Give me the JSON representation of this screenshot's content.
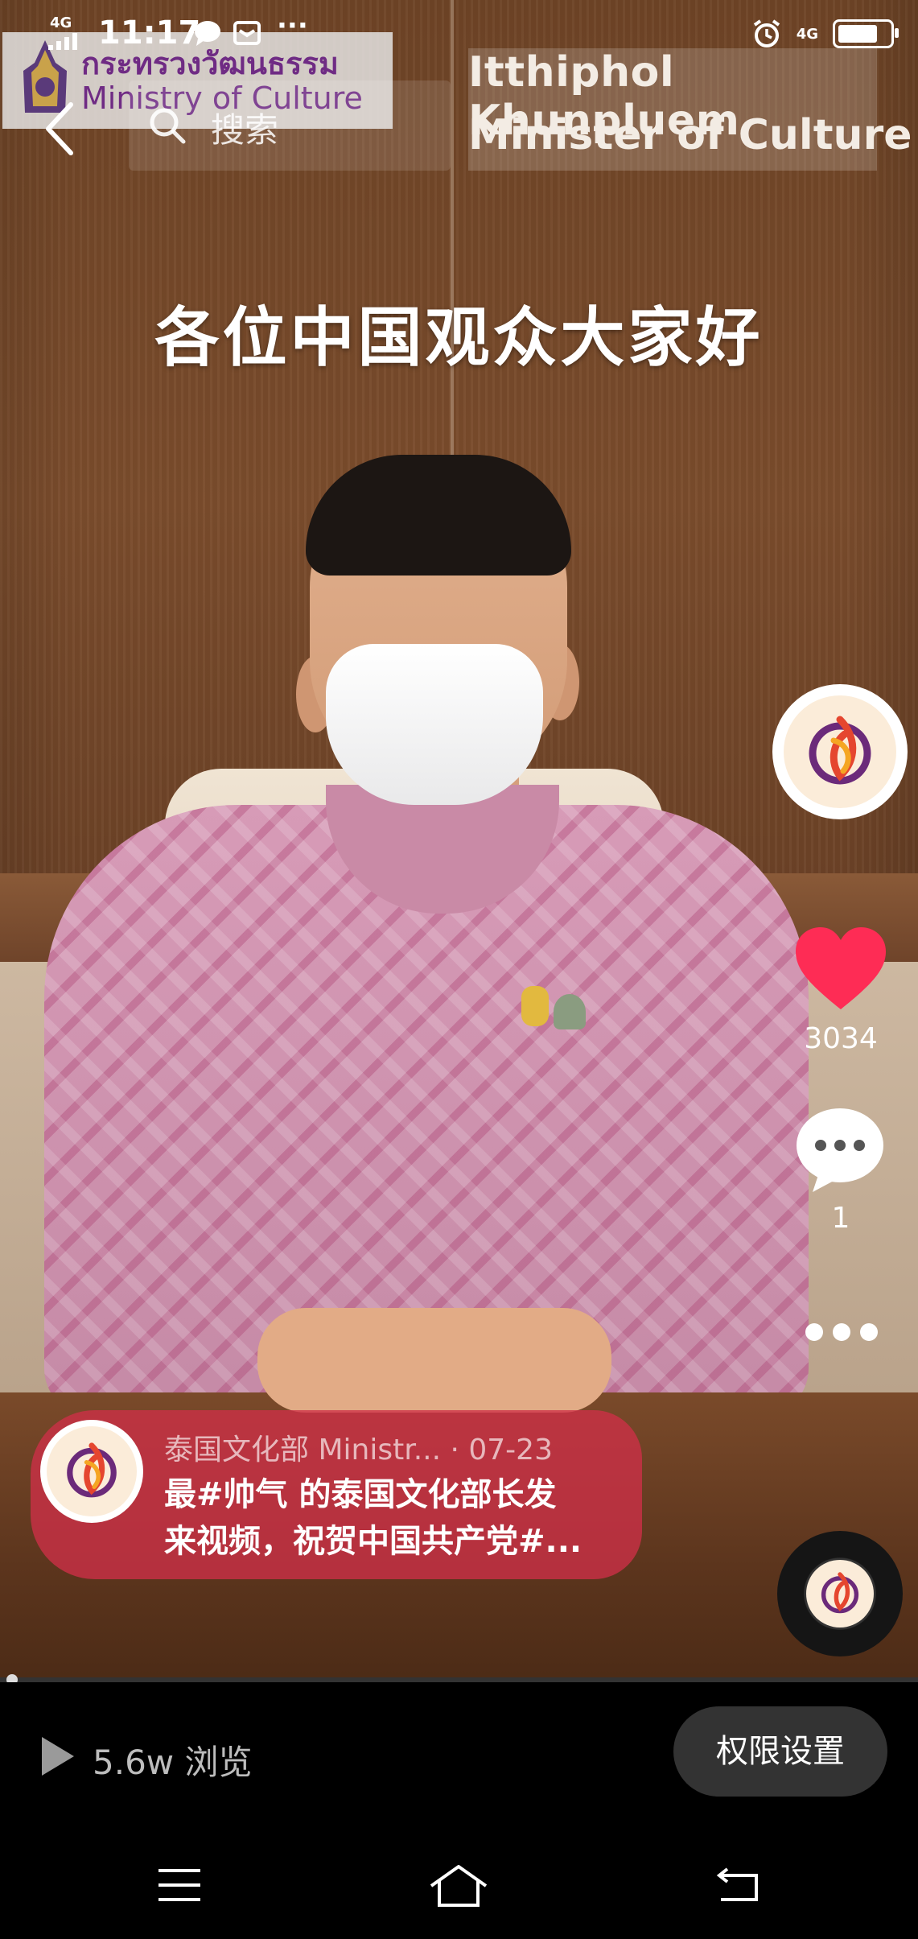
{
  "status_bar": {
    "network_label": "4G",
    "time": "11:17",
    "extra": "···",
    "right_network": "4G",
    "battery_level": 0.85
  },
  "overlay": {
    "logo_thai": "กระทรวงวัฒนธรรม",
    "logo_english": "Ministry of Culture",
    "person_name": "Itthiphol Khunpluem",
    "person_title": "Minister of Culture"
  },
  "search": {
    "placeholder": "搜索"
  },
  "video": {
    "subtitle": "各位中国观众大家好"
  },
  "actions": {
    "like_count": "3034",
    "comment_count": "1"
  },
  "post": {
    "author": "泰国文化部 Ministr...",
    "date": "· 07-23",
    "caption_line1": "最#帅气 的泰国文化部长发",
    "caption_line2": "来视频，祝贺中国共产党#..."
  },
  "footer": {
    "views": "5.6w 浏览",
    "permission_button": "权限设置"
  },
  "colors": {
    "like": "#fe2c55",
    "card": "#ce3048",
    "logo_text": "#6f2b84"
  }
}
